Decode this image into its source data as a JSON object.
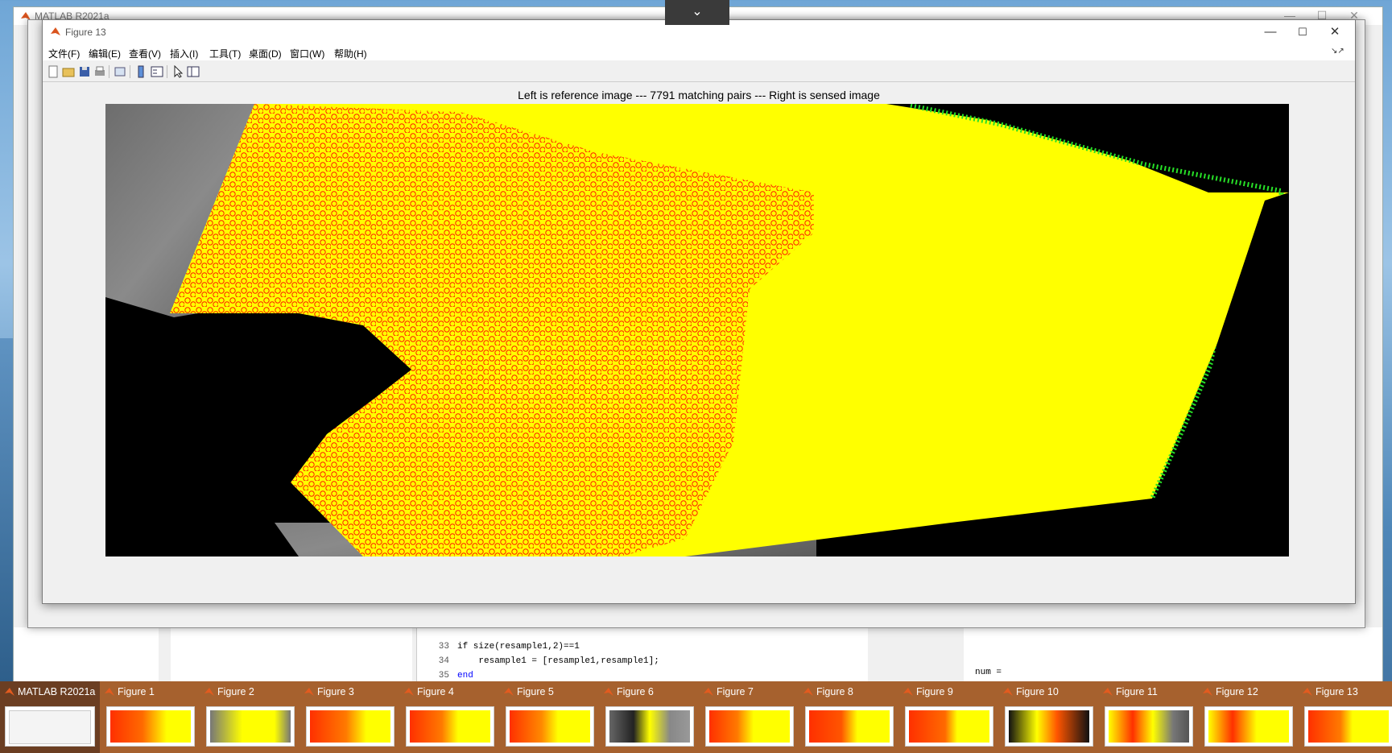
{
  "matlab": {
    "title": "MATLAB R2021a",
    "code_lines": [
      {
        "num": "33",
        "text": "if size(resample1,2)==1"
      },
      {
        "num": "34",
        "text": "    resample1 = [resample1,resample1];"
      },
      {
        "num": "35",
        "text": "end"
      }
    ],
    "cmd_text": "num ="
  },
  "figure": {
    "title": "Figure 13",
    "menus": [
      "文件(F)",
      "编辑(E)",
      "查看(V)",
      "插入(I)",
      "工具(T)",
      "桌面(D)",
      "窗口(W)",
      "帮助(H)"
    ],
    "toolbar_icons": [
      "new-icon",
      "open-icon",
      "save-icon",
      "print-icon",
      "print-preview-icon",
      "colorbar-icon",
      "legend-icon",
      "pointer-icon",
      "property-inspector-icon"
    ],
    "plot_title": "Left is reference image --- 7791 matching pairs --- Right is sensed image",
    "colors": {
      "background": "#000000",
      "match_lines": "#ffff00",
      "ref_points": "#ff0000",
      "sensed_points": "#00ff00"
    }
  },
  "taskbar": {
    "items": [
      {
        "label": "MATLAB R2021a",
        "active": true
      },
      {
        "label": "Figure 1"
      },
      {
        "label": "Figure 2"
      },
      {
        "label": "Figure 3"
      },
      {
        "label": "Figure 4"
      },
      {
        "label": "Figure 5"
      },
      {
        "label": "Figure 6"
      },
      {
        "label": "Figure 7"
      },
      {
        "label": "Figure 8"
      },
      {
        "label": "Figure 9"
      },
      {
        "label": "Figure 10"
      },
      {
        "label": "Figure 11"
      },
      {
        "label": "Figure 12"
      },
      {
        "label": "Figure 13"
      }
    ]
  }
}
